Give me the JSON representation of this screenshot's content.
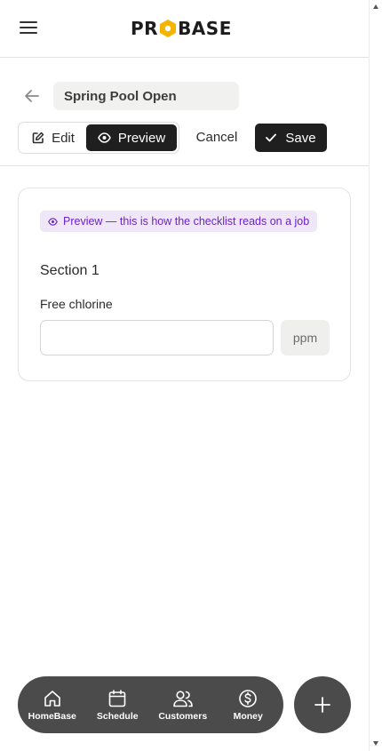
{
  "app": {
    "logo_text_left": "PR",
    "logo_text_right": "BASE",
    "brand_accent": "#f5b400"
  },
  "header": {
    "menu_icon": "hamburger-menu-icon"
  },
  "editor": {
    "back_icon": "arrow-left-icon",
    "checklist_name": "Spring Pool Open",
    "modes": {
      "edit_label": "Edit",
      "preview_label": "Preview",
      "active": "preview"
    },
    "cancel_label": "Cancel",
    "save_label": "Save"
  },
  "preview": {
    "note": "Preview — this is how the checklist reads on a job",
    "note_color": "#6b23c7",
    "section_title": "Section 1",
    "field": {
      "label": "Free chlorine",
      "value": "",
      "unit": "ppm"
    }
  },
  "bottom_nav": {
    "items": [
      {
        "label": "HomeBase",
        "icon": "home-icon"
      },
      {
        "label": "Schedule",
        "icon": "calendar-icon"
      },
      {
        "label": "Customers",
        "icon": "users-icon"
      },
      {
        "label": "Money",
        "icon": "dollar-icon"
      }
    ],
    "fab_icon": "plus-icon"
  }
}
